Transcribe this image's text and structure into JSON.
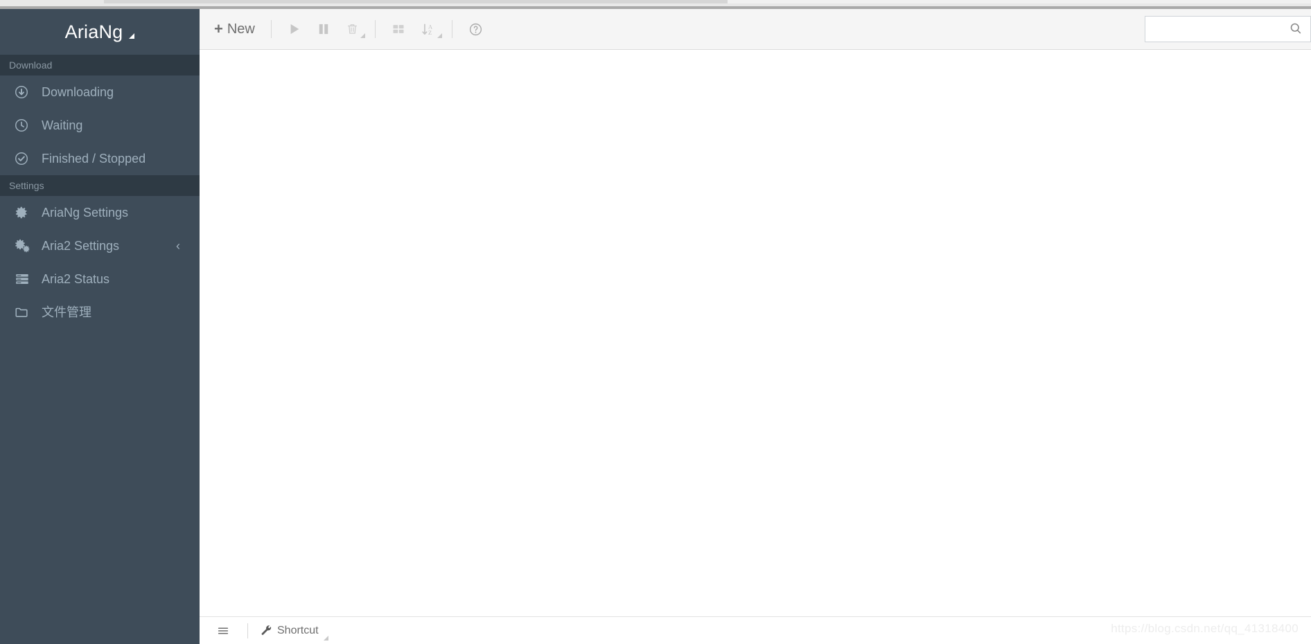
{
  "app": {
    "brand": "AriaNg",
    "brand_caret": "caret-down"
  },
  "sidebar": {
    "sections": [
      {
        "title": "Download",
        "items": [
          {
            "label": "Downloading",
            "icon": "arrow-down-circle-icon",
            "name": "downloading"
          },
          {
            "label": "Waiting",
            "icon": "clock-circle-icon",
            "name": "waiting"
          },
          {
            "label": "Finished / Stopped",
            "icon": "check-circle-icon",
            "name": "finished-stopped"
          }
        ]
      },
      {
        "title": "Settings",
        "items": [
          {
            "label": "AriaNg Settings",
            "icon": "gear-icon",
            "name": "ariang-settings"
          },
          {
            "label": "Aria2 Settings",
            "icon": "gears-icon",
            "name": "aria2-settings",
            "chevron": "‹"
          },
          {
            "label": "Aria2 Status",
            "icon": "server-icon",
            "name": "aria2-status"
          },
          {
            "label": "文件管理",
            "icon": "folder-icon",
            "name": "file-management"
          }
        ]
      }
    ]
  },
  "toolbar": {
    "new_label": "New",
    "buttons": [
      {
        "name": "start-button",
        "icon": "play-icon",
        "title": "Start"
      },
      {
        "name": "pause-button",
        "icon": "pause-icon",
        "title": "Pause"
      },
      {
        "name": "delete-button",
        "icon": "trash-icon",
        "title": "Delete",
        "has_caret": true
      },
      {
        "name": "display-button",
        "icon": "grid-icon",
        "title": "Display"
      },
      {
        "name": "sort-button",
        "icon": "sort-alpha-down-icon",
        "title": "Sort",
        "has_caret": true
      },
      {
        "name": "help-button",
        "icon": "question-circle-icon",
        "title": "Help"
      }
    ]
  },
  "search": {
    "value": "",
    "placeholder": "",
    "icon": "search-icon"
  },
  "footer": {
    "menu_icon": "hamburger-menu-icon",
    "shortcut_label": "Shortcut",
    "shortcut_icon": "wrench-icon"
  },
  "watermark": {
    "text": "https://blog.csdn.net/qq_41318400"
  },
  "colors": {
    "sidebar_bg": "#3e4c59",
    "sidebar_section_bg": "#2e3a44",
    "sidebar_text": "#9fb0bd",
    "toolbar_bg": "#f5f5f5",
    "content_bg": "#ffffff"
  }
}
